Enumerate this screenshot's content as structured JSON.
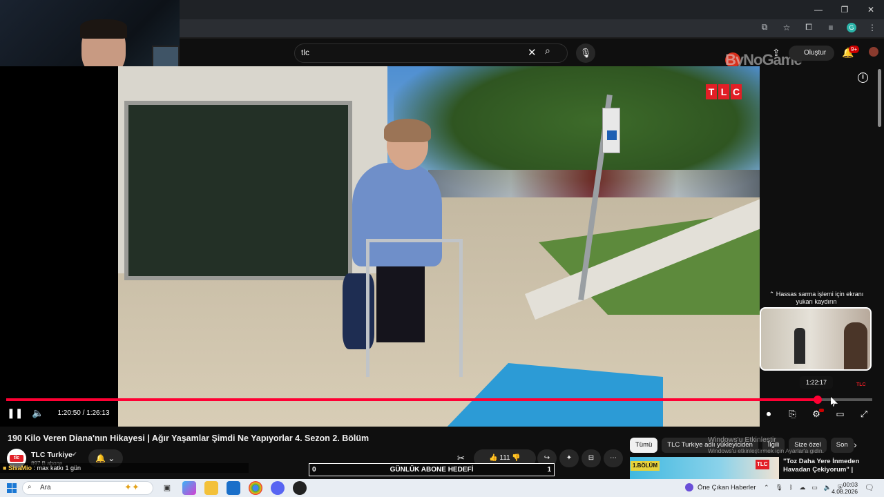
{
  "colors": {
    "accent": "#ff0033",
    "tlc_red": "#e21f26",
    "background": "#0f0f0f"
  },
  "masthead": {
    "search_value": "tlc",
    "create_label": "Oluştur",
    "notification_count": "9+",
    "watermark_text": "ByNoGame"
  },
  "player": {
    "brand_letters": [
      "T",
      "L",
      "C"
    ],
    "elapsed": "1:20:50",
    "duration": "1:26:13",
    "time_display": "1:20:50 / 1:26:13",
    "progress_fraction": 0.937,
    "seek_hint": "Hassas sarma işlemi için ekranı yukarı kaydırın",
    "preview_time": "1:22:17",
    "preview_brand": "TLC"
  },
  "video": {
    "title": "190 Kilo Veren Diana'nın Hikayesi | Ağır Yaşamlar Şimdi Ne Yapıyorlar 4. Sezon 2. Bölüm",
    "channel_name": "TLC Turkiye",
    "subscribers": "897 B abone",
    "like_count": "111"
  },
  "recommendations": {
    "chips": [
      "Tümü",
      "TLC Turkiye adlı yükleyiciden",
      "İlgili",
      "Size özel",
      "Son"
    ],
    "item_badge": "1.BÖLÜM",
    "item_brand": "TLC",
    "item_title": "\"Toz Daha Yere İnmeden Havadan Çekiyorum\" |"
  },
  "windows_activation": {
    "title": "Windows'u Etkinleştir",
    "subtitle": "Windows'u etkinleştirmek için Ayarlar'a gidin."
  },
  "stream_overlay": {
    "chat_user": "SisaMio",
    "chat_message": ": max katkı 1 gün",
    "goal_label": "GÜNLÜK ABONE HEDEFİ",
    "goal_current": "0",
    "goal_target": "1"
  },
  "taskbar": {
    "search_placeholder": "Ara",
    "news_label": "Öne Çıkan Haberler",
    "time": "00:03",
    "date": "4.08.2026"
  }
}
